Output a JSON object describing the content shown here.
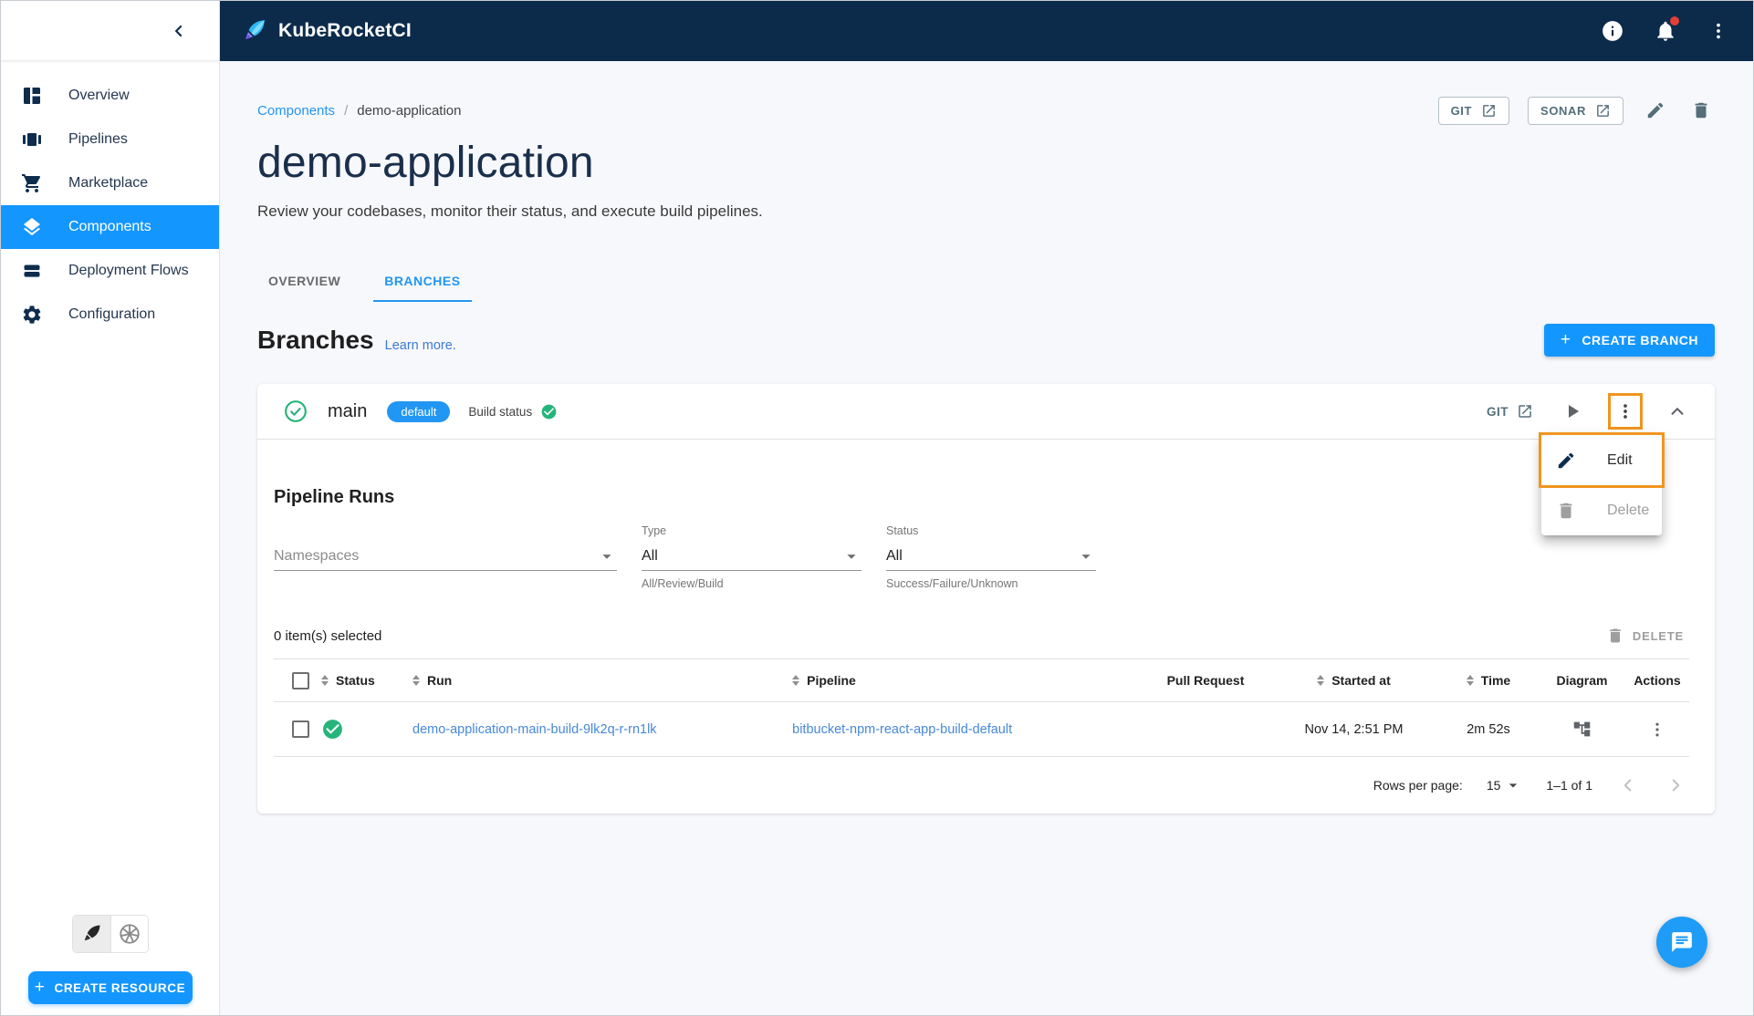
{
  "colors": {
    "topbar_navy": "#0c2b4b",
    "accent_blue": "#1496ff",
    "tab_link_blue": "#2196f3",
    "table_link_blue": "#4688d9",
    "success_green": "#25b57b",
    "highlight_orange": "#f0951f",
    "fab_blue": "#1e9cf7",
    "page_background": "#f7f8fc"
  },
  "topbar": {
    "brand": "KubeRocketCI"
  },
  "sidebar": {
    "items": [
      {
        "label": "Overview",
        "icon": "dashboard-icon"
      },
      {
        "label": "Pipelines",
        "icon": "pipelines-icon"
      },
      {
        "label": "Marketplace",
        "icon": "cart-icon"
      },
      {
        "label": "Components",
        "icon": "layers-icon",
        "selected": true
      },
      {
        "label": "Deployment Flows",
        "icon": "stack-icon"
      },
      {
        "label": "Configuration",
        "icon": "gear-icon"
      }
    ],
    "create_resource_label": "CREATE RESOURCE"
  },
  "breadcrumb": {
    "parent": "Components",
    "separator": "/",
    "current": "demo-application"
  },
  "header_actions": {
    "git_label": "GIT",
    "sonar_label": "SONAR"
  },
  "page": {
    "title": "demo-application",
    "subtitle": "Review your codebases, monitor their status, and execute build pipelines.",
    "tabs": [
      {
        "label": "OVERVIEW"
      },
      {
        "label": "BRANCHES"
      }
    ]
  },
  "branches_section": {
    "heading": "Branches",
    "learn_more_label": "Learn more.",
    "create_branch_label": "CREATE BRANCH"
  },
  "branch": {
    "name": "main",
    "badge": "default",
    "build_status_label": "Build status",
    "git_label": "GIT"
  },
  "branch_menu": {
    "edit_label": "Edit",
    "delete_label": "Delete"
  },
  "pipeline_runs": {
    "heading": "Pipeline Runs",
    "filters": {
      "namespaces_placeholder": "Namespaces",
      "type_label": "Type",
      "type_value": "All",
      "type_helper": "All/Review/Build",
      "status_label": "Status",
      "status_value": "All",
      "status_helper": "Success/Failure/Unknown"
    },
    "selection_text": "0 item(s) selected",
    "delete_label": "DELETE",
    "table": {
      "columns": [
        "",
        "Status",
        "Run",
        "Pipeline",
        "Pull Request",
        "Started at",
        "Time",
        "Diagram",
        "Actions"
      ],
      "rows": [
        {
          "status": "success",
          "run": "demo-application-main-build-9lk2q-r-rn1lk",
          "pipeline": "bitbucket-npm-react-app-build-default",
          "pull_request": "",
          "started_at": "Nov 14, 2:51 PM",
          "time": "2m 52s"
        }
      ]
    },
    "pagination": {
      "rows_per_page_label": "Rows per page:",
      "rows_per_page_value": "15",
      "range_text": "1–1 of 1"
    }
  }
}
